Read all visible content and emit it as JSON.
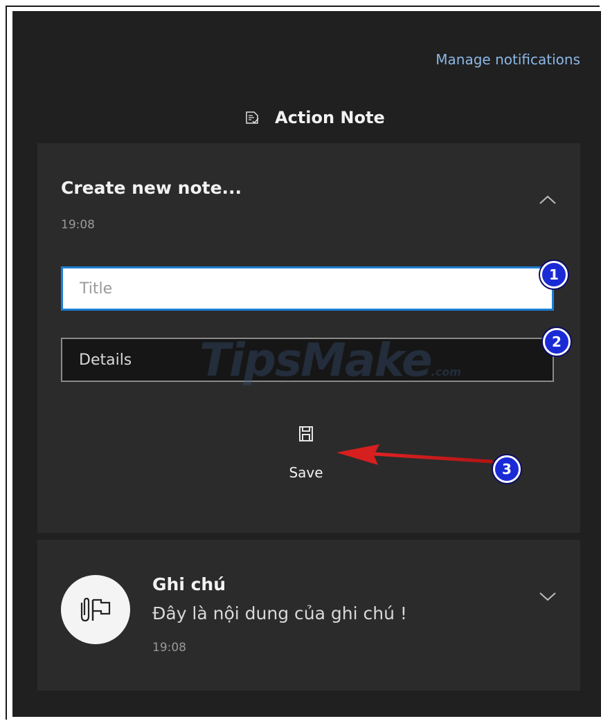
{
  "header": {
    "manage_notifications": "Manage notifications",
    "app_icon": "action-note-icon",
    "app_title": "Action Note"
  },
  "new_note_card": {
    "title": "Create new note...",
    "time": "19:08",
    "collapse_icon": "chevron-up-icon",
    "title_field": {
      "placeholder": "Title",
      "value": ""
    },
    "details_field": {
      "placeholder": "Details",
      "value": ""
    },
    "save_icon": "save-icon",
    "save_label": "Save"
  },
  "note_card": {
    "avatar_icon": "attachment-flag-icon",
    "title": "Ghi chú",
    "body": "Đây là nội dung của ghi chú !",
    "time": "19:08",
    "expand_icon": "chevron-down-icon"
  },
  "annotations": {
    "badge_1": "1",
    "badge_2": "2",
    "badge_3": "3",
    "arrow_color": "#d61f1f",
    "badge_color": "#1a2bd6"
  },
  "watermark": {
    "text": "TipsMake",
    "suffix": ".com"
  },
  "colors": {
    "panel_bg": "#202020",
    "card_bg": "#2b2b2b",
    "link": "#8cb8e6",
    "focus_border": "#1c7fd4"
  }
}
